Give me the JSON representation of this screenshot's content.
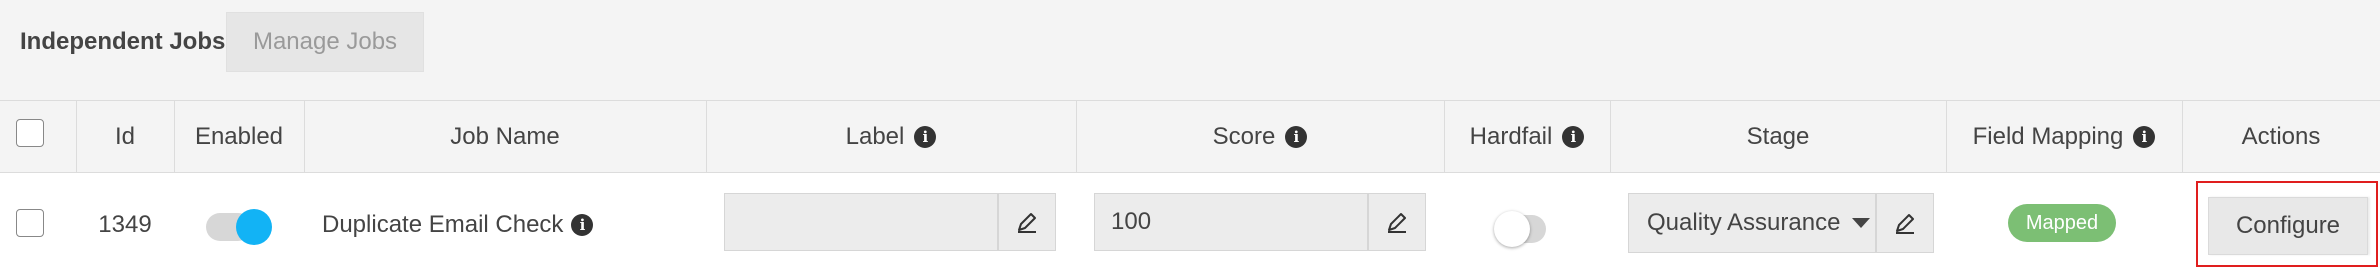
{
  "header": {
    "title": "Independent Jobs",
    "manage_jobs_label": "Manage Jobs"
  },
  "table": {
    "columns": {
      "id": "Id",
      "enabled": "Enabled",
      "job_name": "Job Name",
      "label": "Label",
      "score": "Score",
      "hardfail": "Hardfail",
      "stage": "Stage",
      "field_mapping": "Field Mapping",
      "actions": "Actions"
    },
    "row": {
      "id": "1349",
      "enabled": true,
      "job_name": "Duplicate Email Check",
      "label_value": "",
      "score_value": "100",
      "hardfail": false,
      "stage_value": "Quality Assurance",
      "field_mapping_status": "Mapped",
      "action_label": "Configure"
    }
  },
  "icons": {
    "info": "info-icon",
    "edit": "pencil-icon",
    "dropdown": "caret-down-icon"
  },
  "colors": {
    "toggle_on": "#12b3f5",
    "mapped_badge": "#7cbf74",
    "highlight": "#e01e1e"
  }
}
